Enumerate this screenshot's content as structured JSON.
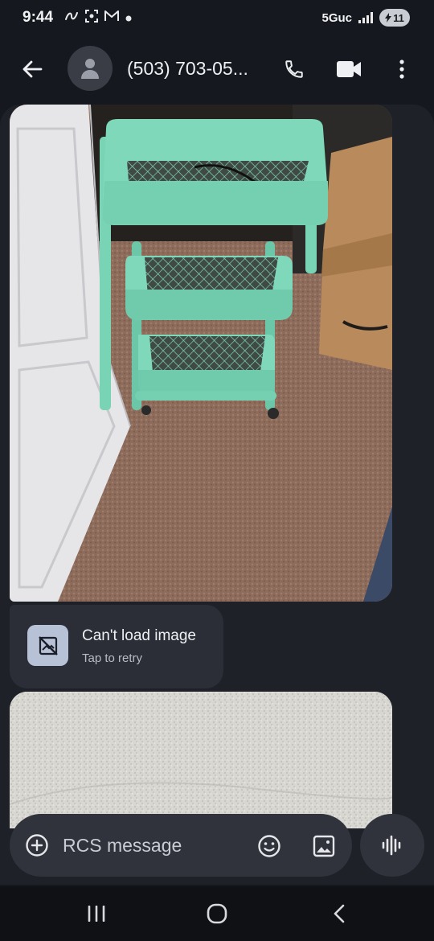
{
  "status_bar": {
    "time": "9:44",
    "left_icons": [
      "link-icon",
      "screenshot-icon",
      "gmail-icon",
      "dot-icon"
    ],
    "network": "5Guc",
    "battery": "11"
  },
  "header": {
    "contact": "(503) 703-05...",
    "back_icon": "arrow-back-icon",
    "call_icon": "phone-icon",
    "video_icon": "videocam-icon",
    "more_icon": "more-vert-icon"
  },
  "messages": [
    {
      "type": "image",
      "subject": "mint-green-rolling-cart-on-carpet"
    },
    {
      "type": "failed-image",
      "title": "Can't load image",
      "subtitle": "Tap to retry",
      "icon": "broken-image-icon"
    },
    {
      "type": "image",
      "subject": "textured-wall"
    }
  ],
  "composer": {
    "placeholder": "RCS message",
    "add_icon": "add-circle-icon",
    "emoji_icon": "emoji-icon",
    "gallery_icon": "gallery-icon",
    "voice_icon": "voice-waveform-icon"
  },
  "colors": {
    "background": "#15181e",
    "panel": "#1e2128",
    "bubble": "#2b2e36",
    "composer": "#30333b",
    "accent_icon_box": "#b8c2d6"
  }
}
